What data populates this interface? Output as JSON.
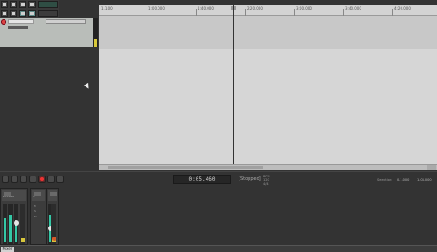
{
  "toolbar": {
    "buttons": [
      "new-project",
      "open-project",
      "save-project",
      "project-settings",
      "undo",
      "redo",
      "metronome",
      "snap",
      "grid",
      "lock",
      "ripple",
      "item-edit"
    ]
  },
  "track": {
    "name": "",
    "meter_level": 0.28
  },
  "ruler": {
    "labels": [
      "1.1.00",
      "0:00.000",
      "1:00.000",
      "1:40.000",
      "2:20.000",
      "3:00.000",
      "3:40.000",
      "4:20.000"
    ]
  },
  "transport": {
    "time": "0:05.460",
    "status": "[Stopped]",
    "bpm_label": "BPM",
    "bpm_value": "120",
    "sig_value": "4/4",
    "selection_label": "Selection:",
    "selection_start": "0.1.000",
    "selection_end": "1.04.000"
  },
  "mixer": {
    "master_label": "MASTER",
    "track_label": "1",
    "strip_tags": [
      "M",
      "S",
      "FX"
    ]
  },
  "bottom": {
    "mixer_tab_label": "Mixer"
  },
  "colors": {
    "accent_teal": "#34c7a5",
    "record_red": "#e33333",
    "meter_yellow": "#d7c63c"
  }
}
